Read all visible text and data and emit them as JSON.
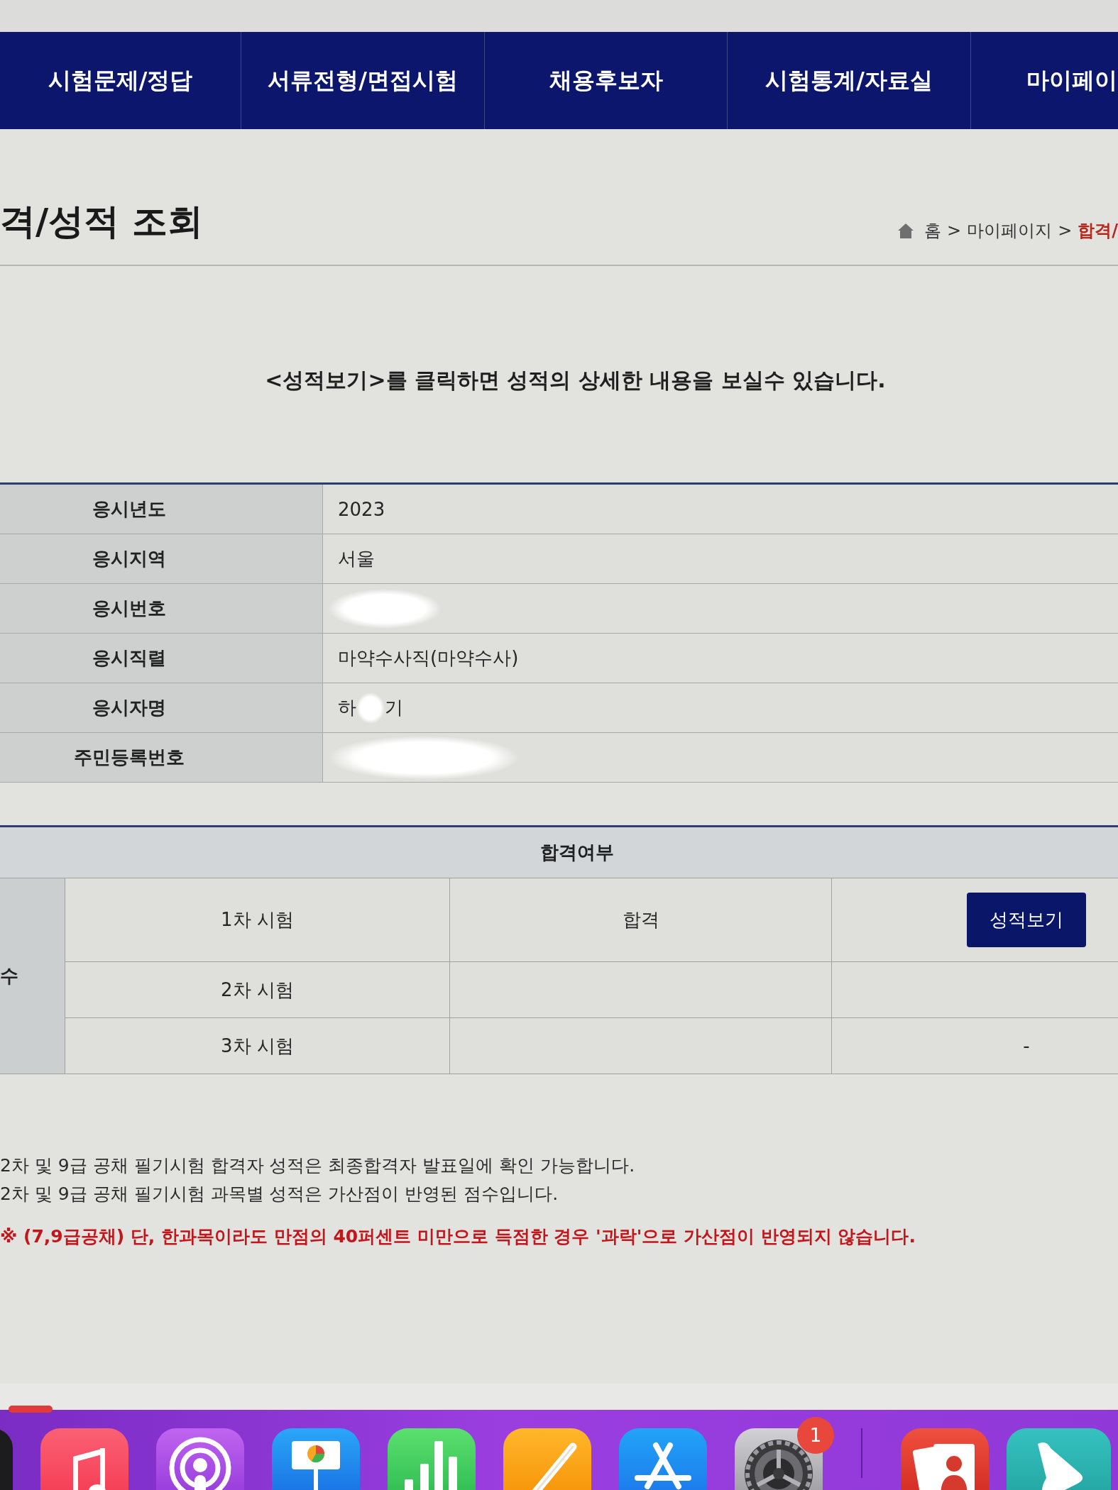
{
  "nav": {
    "tabs": [
      {
        "label": "시험문제/정답"
      },
      {
        "label": "서류전형/면접시험"
      },
      {
        "label": "채용후보자"
      },
      {
        "label": "시험통계/자료실"
      },
      {
        "label": "마이페이"
      }
    ]
  },
  "title_bar": {
    "title": "격/성적 조회",
    "breadcrumb": [
      {
        "kind": "link",
        "text": "홈"
      },
      {
        "kind": "separator",
        "text": ">"
      },
      {
        "kind": "link",
        "text": "마이페이지"
      },
      {
        "kind": "separator",
        "text": ">"
      },
      {
        "kind": "current",
        "text": "합격/"
      }
    ]
  },
  "instruction": "<성적보기>를 클릭하면 성적의 상세한 내용을 보실수 있습니다.",
  "applicant_table": {
    "rows": [
      {
        "label": "응시년도",
        "value": [
          {
            "kind": "text",
            "text": "2023"
          }
        ]
      },
      {
        "label": "응시지역",
        "value": [
          {
            "kind": "text",
            "text": "서울"
          }
        ]
      },
      {
        "label": "응시번호",
        "value": [
          {
            "kind": "smudge"
          }
        ]
      },
      {
        "label": "응시직렬",
        "value": [
          {
            "kind": "text",
            "text": "마약수사직(마약수사)"
          }
        ]
      },
      {
        "label": "응시자명",
        "value": [
          {
            "kind": "text",
            "text": "하"
          },
          {
            "kind": "dab"
          },
          {
            "kind": "text",
            "text": "기"
          }
        ]
      },
      {
        "label": "주민등록번호",
        "value": [
          {
            "kind": "wipe"
          }
        ]
      }
    ]
  },
  "result_table": {
    "header": "합격여부",
    "group_label": "수",
    "rows": [
      {
        "exam": "1차 시험",
        "result": "합격",
        "action": {
          "kind": "button",
          "text": "성적보기"
        }
      },
      {
        "exam": "2차 시험"
      },
      {
        "exam": "3차 시험",
        "action": {
          "kind": "text",
          "text": "-"
        }
      }
    ]
  },
  "notes": [
    {
      "kind": "plain",
      "text": "2차 및 9급 공채 필기시험 합격자 성적은 최종합격자 발표일에 확인 가능합니다."
    },
    {
      "kind": "plain",
      "text": "2차 및 9급 공채 필기시험 과목별 성적은 가산점이 반영된 점수입니다."
    },
    {
      "kind": "warning",
      "text": "※ (7,9급공채) 단, 한과목이라도 만점의 40퍼센트 미만으로 득점한 경우 '과락'으로 가산점이 반영되지 않습니다."
    }
  ],
  "dock": {
    "settings_badge": "1"
  }
}
